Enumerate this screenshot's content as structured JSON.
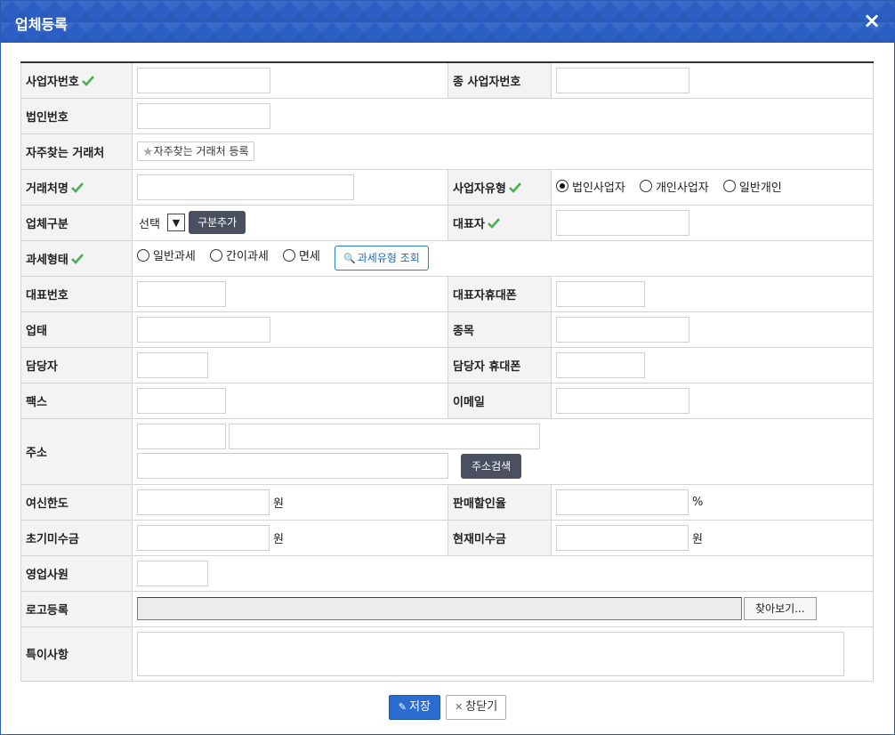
{
  "window": {
    "title": "업체등록",
    "close_icon": "×"
  },
  "colors": {
    "titlebar": "#2b5fc4",
    "check": "#4caf50",
    "primary_button": "#2b6cd1",
    "dark_button": "#4a5060"
  },
  "fields": {
    "biz_no": {
      "label": "사업자번호",
      "value": ""
    },
    "sub_biz_no": {
      "label": "종 사업자번호",
      "value": ""
    },
    "corp_no": {
      "label": "법인번호",
      "value": ""
    },
    "favorite": {
      "label": "자주찾는 거래처",
      "button": "자주찾는 거래처 등록"
    },
    "company_name": {
      "label": "거래처명",
      "value": ""
    },
    "biz_type": {
      "label": "사업자유형",
      "options": [
        "법인사업자",
        "개인사업자",
        "일반개인"
      ],
      "selected": "법인사업자"
    },
    "category": {
      "label": "업체구분",
      "selected": "선택",
      "add_button": "구분추가"
    },
    "ceo": {
      "label": "대표자",
      "value": ""
    },
    "tax_type": {
      "label": "과세형태",
      "options": [
        "일반과세",
        "간이과세",
        "면세"
      ],
      "selected": "",
      "lookup_button": "과세유형 조회"
    },
    "main_phone": {
      "label": "대표번호",
      "value": ""
    },
    "ceo_mobile": {
      "label": "대표자휴대폰",
      "value": ""
    },
    "business_cat": {
      "label": "업태",
      "value": ""
    },
    "business_item": {
      "label": "종목",
      "value": ""
    },
    "manager": {
      "label": "담당자",
      "value": ""
    },
    "manager_mobile": {
      "label": "담당자 휴대폰",
      "value": ""
    },
    "fax": {
      "label": "팩스",
      "value": ""
    },
    "email": {
      "label": "이메일",
      "value": ""
    },
    "address": {
      "label": "주소",
      "search_button": "주소검색"
    },
    "credit_limit": {
      "label": "여신한도",
      "value": "",
      "unit": "원"
    },
    "discount_rate": {
      "label": "판매할인율",
      "value": "",
      "unit": "%"
    },
    "initial_receivable": {
      "label": "초기미수금",
      "value": "",
      "unit": "원"
    },
    "current_receivable": {
      "label": "현재미수금",
      "value": "",
      "unit": "원"
    },
    "sales_rep": {
      "label": "영업사원",
      "value": ""
    },
    "logo": {
      "label": "로고등록",
      "browse_button": "찾아보기..."
    },
    "notes": {
      "label": "특이사항",
      "value": ""
    }
  },
  "footer": {
    "save_label": "저장",
    "close_label": "창닫기"
  }
}
